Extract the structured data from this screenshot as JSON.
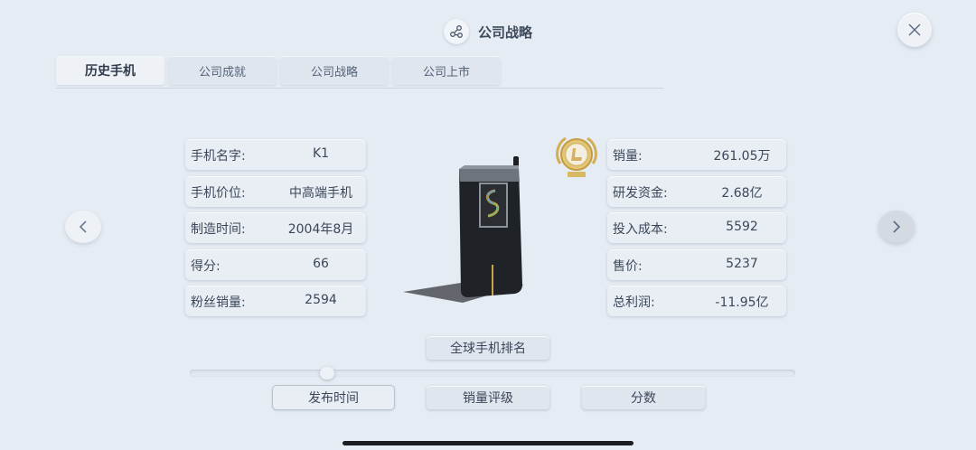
{
  "header": {
    "title": "公司战略",
    "icon": "share-nodes-icon"
  },
  "tabs": [
    {
      "label": "历史手机",
      "active": true
    },
    {
      "label": "公司成就",
      "active": false
    },
    {
      "label": "公司战略",
      "active": false
    },
    {
      "label": "公司上市",
      "active": false
    }
  ],
  "phone_info": {
    "left": [
      {
        "label": "手机名字:",
        "value": "K1"
      },
      {
        "label": "手机价位:",
        "value": "中高端手机"
      },
      {
        "label": "制造时间:",
        "value": "2004年8月"
      },
      {
        "label": "得分:",
        "value": "66"
      },
      {
        "label": "粉丝销量:",
        "value": "2594"
      }
    ],
    "right": [
      {
        "label": "销量:",
        "value": "261.05万"
      },
      {
        "label": "研发资金:",
        "value": "2.68亿"
      },
      {
        "label": "投入成本:",
        "value": "5592"
      },
      {
        "label": "售价:",
        "value": "5237"
      },
      {
        "label": "总利润:",
        "value": "-11.95亿"
      }
    ]
  },
  "medal": {
    "icon": "gold-medal-icon"
  },
  "global_ranking_button": "全球手机排名",
  "timeline_slider": {
    "position": 0.22
  },
  "sort_buttons": [
    {
      "label": "发布时间",
      "selected": true
    },
    {
      "label": "销量评级",
      "selected": false
    },
    {
      "label": "分数",
      "selected": false
    }
  ],
  "colors": {
    "background": "#e6ecf3",
    "panel": "#e9eef4",
    "text": "#3b4759",
    "medal_gold": "#d9b862"
  }
}
